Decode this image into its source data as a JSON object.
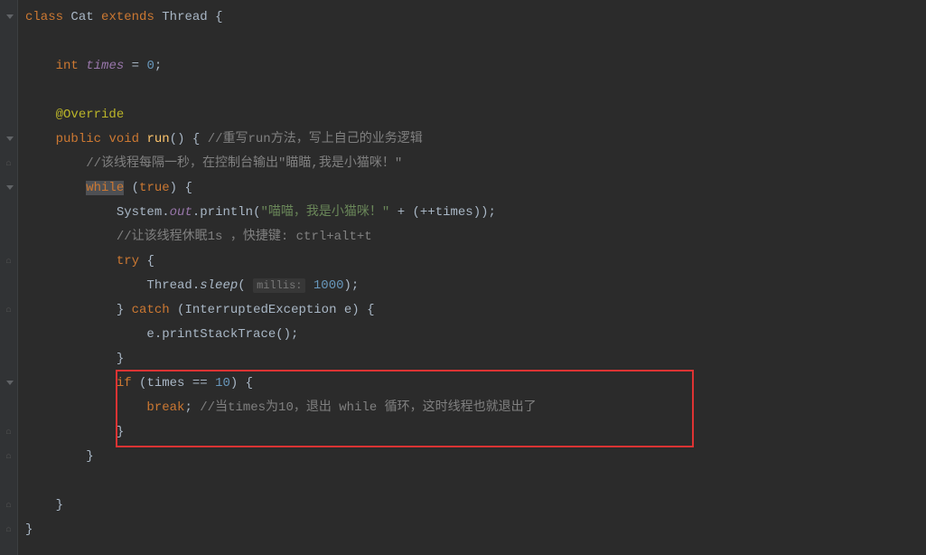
{
  "code": {
    "line1": {
      "kw1": "class",
      "name": "Cat",
      "kw2": "extends",
      "parent": "Thread",
      "brace": " {"
    },
    "line3": {
      "kw": "int",
      "var": "times",
      "eq": " = ",
      "val": "0",
      "end": ";"
    },
    "line5": {
      "annotation": "@Override"
    },
    "line6": {
      "kw1": "public",
      "kw2": "void",
      "method": "run",
      "sig": "() { ",
      "comment": "//重写run方法，写上自己的业务逻辑"
    },
    "line7": {
      "comment": "//该线程每隔一秒，在控制台输出\"瞄瞄,我是小猫咪！\""
    },
    "line8": {
      "kw": "while",
      "cond": " (",
      "true": "true",
      "end": ") {"
    },
    "line9": {
      "cls": "System.",
      "field": "out",
      "dot": ".",
      "method": "println",
      "open": "(",
      "str": "\"喵喵，我是小猫咪！\"",
      "plus": " + (++times));"
    },
    "line10": {
      "comment": "//让该线程休眠1s ，快捷键: ctrl+alt+t"
    },
    "line11": {
      "kw": "try",
      "brace": " {"
    },
    "line12": {
      "cls": "Thread.",
      "method": "sleep",
      "open": "( ",
      "hint": "millis:",
      "space": " ",
      "val": "1000",
      "close": ");"
    },
    "line13": {
      "close": "} ",
      "kw": "catch",
      "open": " (InterruptedException e) {"
    },
    "line14": {
      "call": "e.printStackTrace();"
    },
    "line15": {
      "close": "}"
    },
    "line16": {
      "kw": "if",
      "open": " (times == ",
      "val": "10",
      "close": ") {"
    },
    "line17": {
      "kw": "break",
      "semi": "; ",
      "comment": "//当times为10，退出 while 循环，这时线程也就退出了"
    },
    "line18": {
      "close": "}"
    },
    "line19": {
      "close": "}"
    },
    "line21": {
      "close": "}"
    },
    "line22": {
      "close": "}"
    }
  }
}
